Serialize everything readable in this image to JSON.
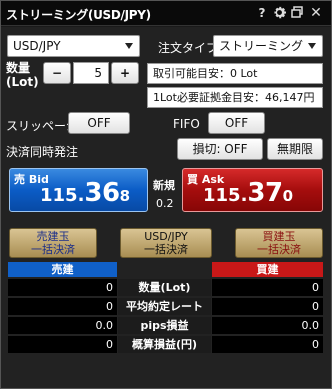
{
  "window": {
    "title": "ストリーミング(USD/JPY)"
  },
  "symbol": {
    "selected": "USD/JPY"
  },
  "order_type": {
    "label": "注文タイプ",
    "selected": "ストリーミング"
  },
  "quantity": {
    "label_line1": "数量",
    "label_line2": "(Lot)",
    "minus": "−",
    "plus": "+",
    "value": "5"
  },
  "info": {
    "available_lot": "取引可能目安：0 Lot",
    "margin_per_lot": "1Lot必要証拠金目安：46,147円"
  },
  "slippage": {
    "label": "スリッページ",
    "value": "OFF"
  },
  "fifo": {
    "label": "FIFO",
    "value": "OFF"
  },
  "simultaneous": {
    "label": "決済同時発注",
    "stop_loss": "損切: OFF",
    "duration": "無期限"
  },
  "bid": {
    "tag": "売 Bid",
    "prefix": "115.",
    "big": "36",
    "tiny": "8"
  },
  "ask": {
    "tag": "買 Ask",
    "prefix": "115.",
    "big": "37",
    "tiny": "0"
  },
  "spread": {
    "label": "新規",
    "value": "0.2"
  },
  "bulk": {
    "sell": {
      "line1": "売建玉",
      "line2": "一括決済"
    },
    "pair": {
      "line1": "USD/JPY",
      "line2": "一括決済"
    },
    "buy": {
      "line1": "買建玉",
      "line2": "一括決済"
    }
  },
  "table": {
    "sell_header": "売建",
    "buy_header": "買建",
    "rows": [
      {
        "label": "数量(Lot)",
        "sell": "0",
        "buy": "0"
      },
      {
        "label": "平均約定レート",
        "sell": "0",
        "buy": "0"
      },
      {
        "label": "pips損益",
        "sell": "0.0",
        "buy": "0.0"
      },
      {
        "label": "概算損益(円)",
        "sell": "0",
        "buy": "0"
      }
    ]
  },
  "colors": {
    "bid": "#0b5cc6",
    "ask": "#a50d0d",
    "sell_header": "#1060c8",
    "buy_header": "#c81818",
    "bulk": "#c2aa70"
  },
  "icons": [
    "question-icon",
    "gear-icon",
    "restore-icon",
    "close-icon"
  ]
}
